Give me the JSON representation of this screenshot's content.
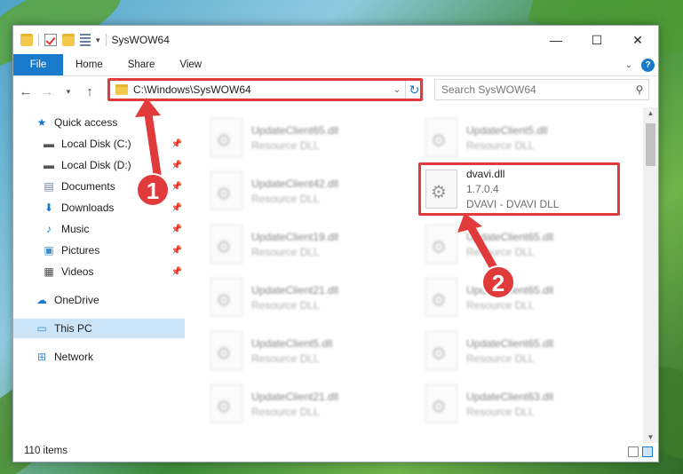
{
  "window": {
    "title": "SysWOW64"
  },
  "ribbon": {
    "tabs": [
      "File",
      "Home",
      "Share",
      "View"
    ]
  },
  "address": {
    "path": "C:\\Windows\\SysWOW64"
  },
  "search": {
    "placeholder": "Search SysWOW64"
  },
  "sidebar": {
    "items": [
      {
        "label": "Quick access",
        "icon": "star-icon"
      },
      {
        "label": "Local Disk (C:)",
        "icon": "drive-icon",
        "pinned": true
      },
      {
        "label": "Local Disk (D:)",
        "icon": "drive-icon",
        "pinned": true
      },
      {
        "label": "Documents",
        "icon": "documents-icon",
        "pinned": true
      },
      {
        "label": "Downloads",
        "icon": "downloads-icon",
        "pinned": true
      },
      {
        "label": "Music",
        "icon": "music-icon",
        "pinned": true
      },
      {
        "label": "Pictures",
        "icon": "pictures-icon",
        "pinned": true
      },
      {
        "label": "Videos",
        "icon": "videos-icon",
        "pinned": true
      },
      {
        "label": "OneDrive",
        "icon": "cloud-icon"
      },
      {
        "label": "This PC",
        "icon": "pc-icon",
        "selected": true
      },
      {
        "label": "Network",
        "icon": "network-icon"
      }
    ]
  },
  "files": {
    "left": [
      {
        "name": "UpdateClient65.dll",
        "sub": "Resource DLL"
      },
      {
        "name": "UpdateClient42.dll",
        "sub": "Resource DLL"
      },
      {
        "name": "UpdateClient19.dll",
        "sub": "Resource DLL"
      },
      {
        "name": "UpdateClient21.dll",
        "sub": "Resource DLL"
      },
      {
        "name": "UpdateClient5.dll",
        "sub": "Resource DLL"
      },
      {
        "name": "UpdateClient21.dll",
        "sub": "Resource DLL"
      }
    ],
    "right": [
      {
        "name": "UpdateClient5.dll",
        "sub": "Resource DLL"
      },
      {
        "name": "dvavi.dll",
        "version": "1.7.0.4",
        "description": "DVAVI - DVAVI DLL",
        "highlighted": true
      },
      {
        "name": "UpdateClient65.dll",
        "sub": "Resource DLL"
      },
      {
        "name": "UpdateClient65.dll",
        "sub": "Resource DLL"
      },
      {
        "name": "UpdateClient65.dll",
        "sub": "Resource DLL"
      },
      {
        "name": "UpdateClient63.dll",
        "sub": "Resource DLL"
      }
    ]
  },
  "status": {
    "item_count": "110 items"
  },
  "annotations": {
    "marker1": "1",
    "marker2": "2"
  },
  "colors": {
    "accent": "#1979ca",
    "annotation": "#e03a3a"
  }
}
